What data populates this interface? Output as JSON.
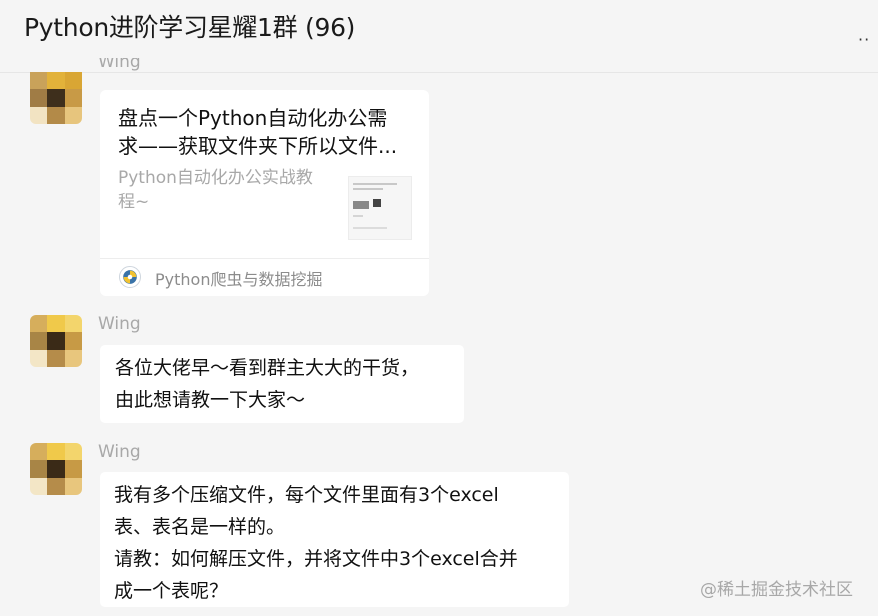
{
  "header": {
    "title": "Python进阶学习星耀1群 (96)",
    "more_label": "··"
  },
  "messages": [
    {
      "sender": "Wing",
      "type": "link-card",
      "card": {
        "title_lines": [
          "盘点一个Python自动化办公需",
          "求——获取文件夹下所以文件..."
        ],
        "desc_lines": [
          "Python自动化办公实战教",
          "程~"
        ],
        "source": "Python爬虫与数据挖掘"
      }
    },
    {
      "sender": "Wing",
      "type": "text",
      "lines": [
        "各位大佬早～看到群主大大的干货，",
        "由此想请教一下大家～"
      ]
    },
    {
      "sender": "Wing",
      "type": "text",
      "lines": [
        "我有多个压缩文件，每个文件里面有3个excel",
        "表、表名是一样的。",
        "请教：如何解压文件，并将文件中3个excel合并",
        "成一个表呢？"
      ]
    }
  ],
  "watermark": "@稀土掘金技术社区",
  "icons": {
    "avatar": "pixelated-avatar-icon",
    "card_source": "python-logo-icon",
    "minimize": "minimize-icon",
    "maximize": "maximize-icon",
    "close": "close-icon",
    "more": "more-options-icon"
  },
  "colors": {
    "background": "#f5f5f5",
    "bubble": "#ffffff",
    "sender_name": "#a8a8a8"
  }
}
